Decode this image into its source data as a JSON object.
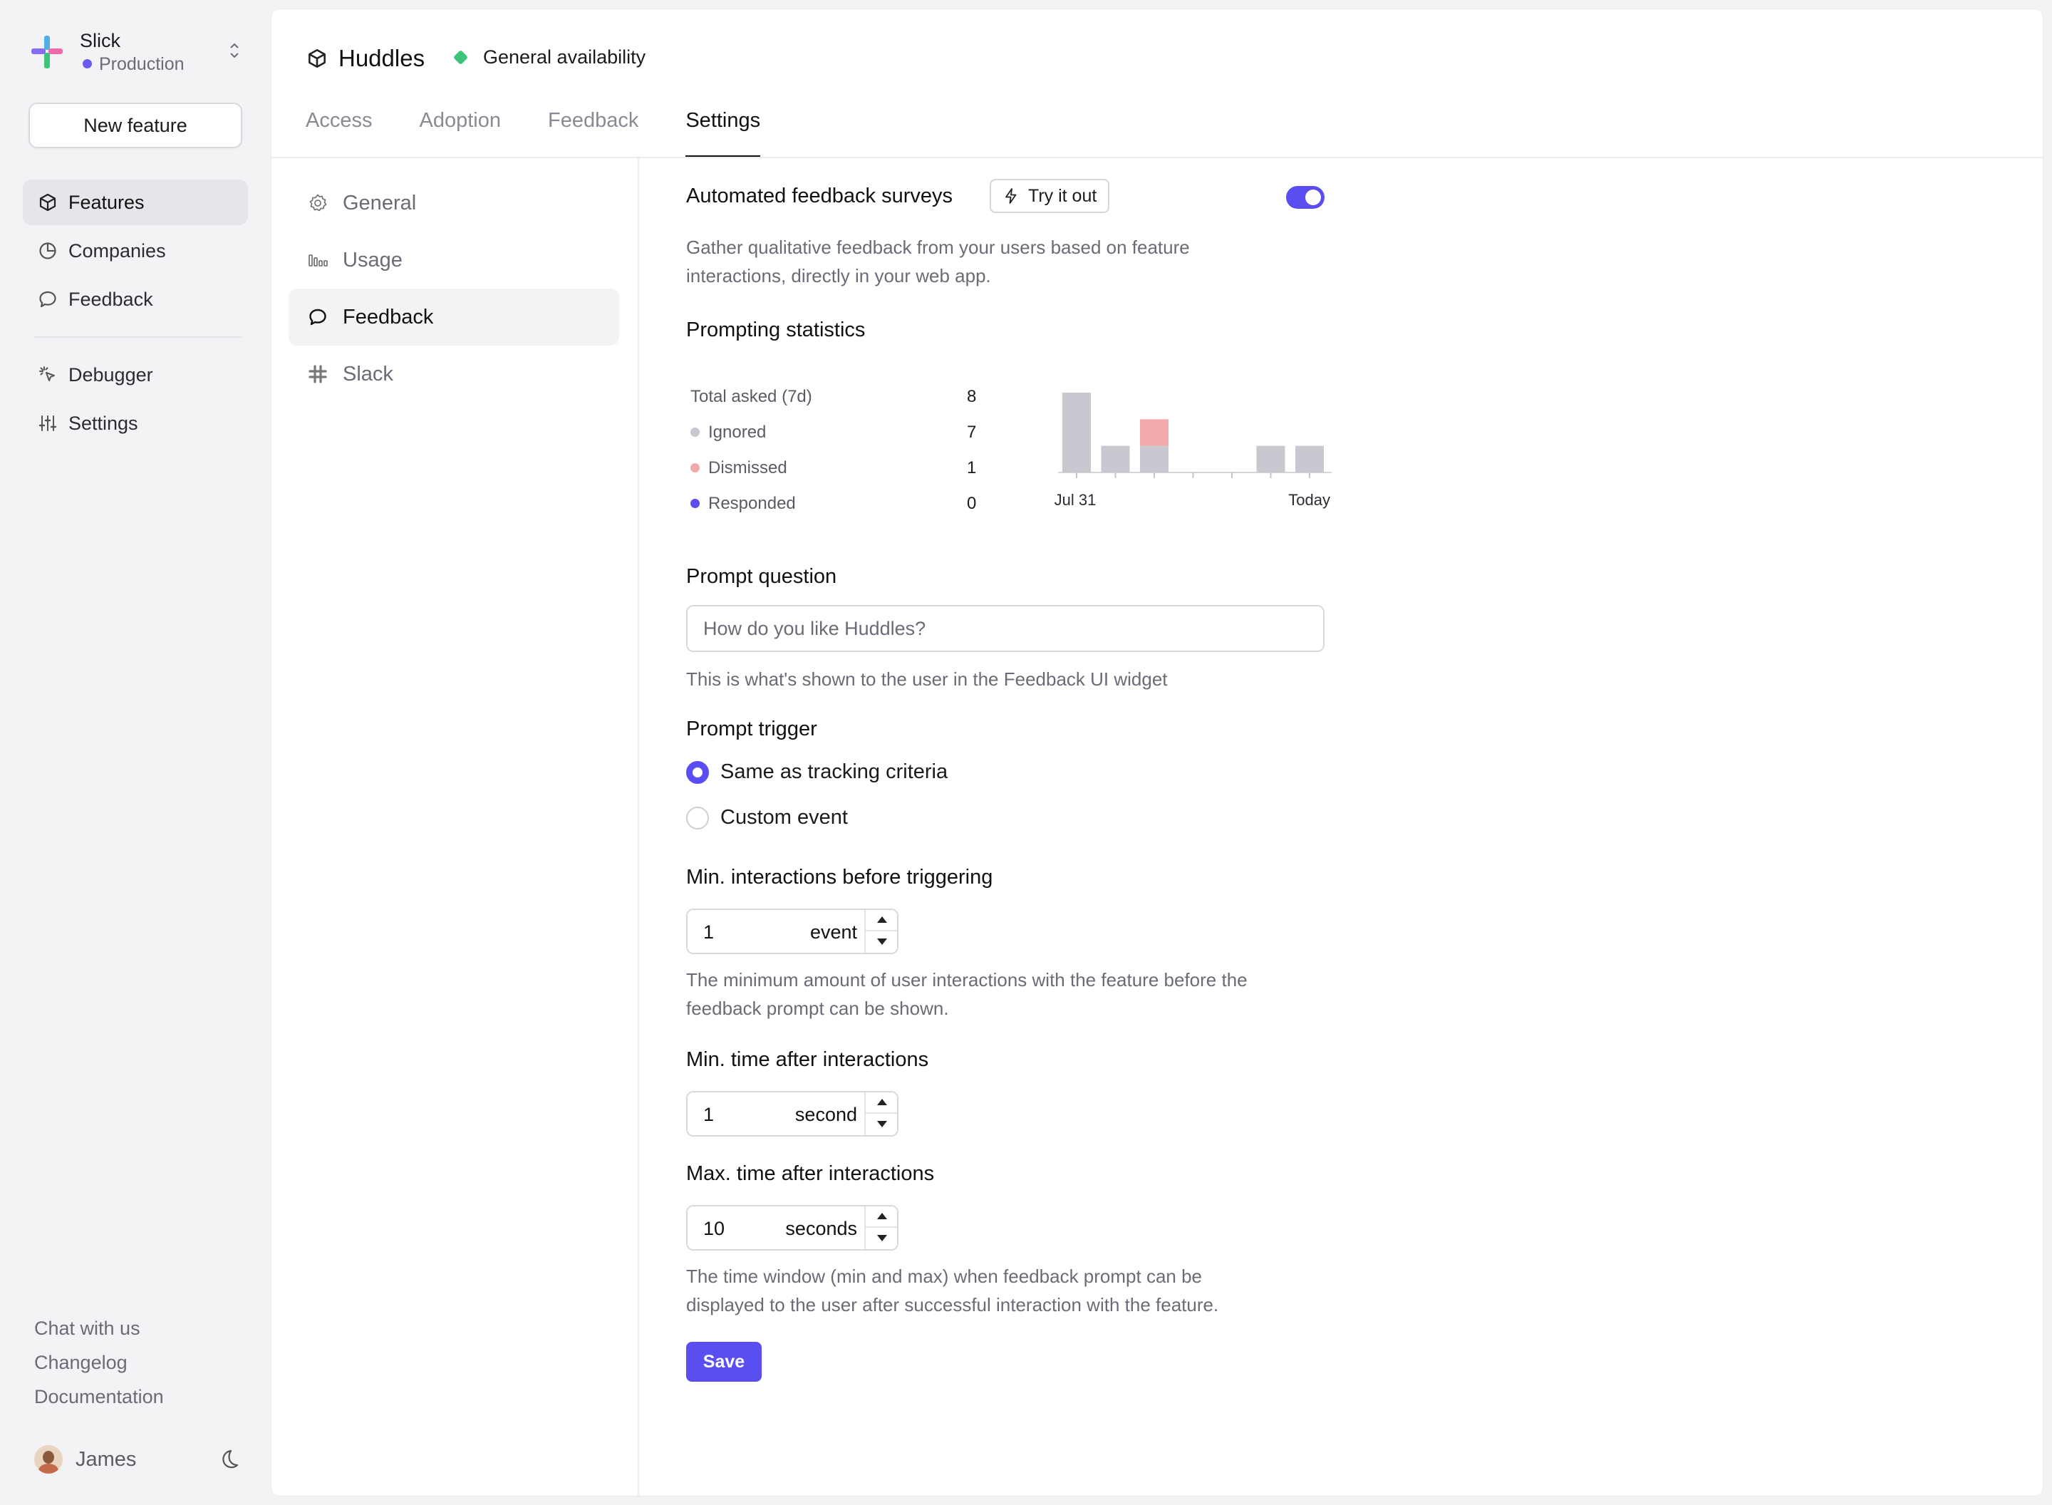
{
  "org": {
    "name": "Slick",
    "environment": "Production"
  },
  "sidebar": {
    "new_feature_label": "New feature",
    "primary": [
      {
        "label": "Features",
        "active": true
      },
      {
        "label": "Companies",
        "active": false
      },
      {
        "label": "Feedback",
        "active": false
      }
    ],
    "secondary": [
      {
        "label": "Debugger"
      },
      {
        "label": "Settings"
      }
    ],
    "footer_links": [
      "Chat with us",
      "Changelog",
      "Documentation"
    ],
    "user_name": "James"
  },
  "header": {
    "title": "Huddles",
    "status_label": "General availability",
    "status_color": "#3ec47a",
    "tabs": [
      {
        "label": "Access",
        "active": false
      },
      {
        "label": "Adoption",
        "active": false
      },
      {
        "label": "Feedback",
        "active": false
      },
      {
        "label": "Settings",
        "active": true
      }
    ]
  },
  "settings_nav": [
    {
      "label": "General",
      "icon": "gear-icon",
      "active": false
    },
    {
      "label": "Usage",
      "icon": "bars-icon",
      "active": false
    },
    {
      "label": "Feedback",
      "icon": "chat-bubble-icon",
      "active": true
    },
    {
      "label": "Slack",
      "icon": "slack-icon",
      "active": false
    }
  ],
  "feedback": {
    "surveys_title": "Automated feedback surveys",
    "try_label": "Try it out",
    "enabled": true,
    "surveys_help": [
      "Gather qualitative feedback from your users based on feature",
      "interactions, directly in your web app."
    ],
    "stats_title": "Prompting statistics",
    "stats": [
      {
        "label": "Total asked (7d)",
        "value": "8",
        "dot": null
      },
      {
        "label": "Ignored",
        "value": "7",
        "dot": "#c8c8d0"
      },
      {
        "label": "Dismissed",
        "value": "1",
        "dot": "#f2a9a9"
      },
      {
        "label": "Responded",
        "value": "0",
        "dot": "#5b4ef0"
      }
    ],
    "prompt_question_label": "Prompt question",
    "prompt_question_placeholder": "How do you like Huddles?",
    "prompt_question_help": "This is what's shown to the user in the Feedback UI widget",
    "prompt_trigger_label": "Prompt trigger",
    "trigger_options": [
      {
        "label": "Same as tracking criteria",
        "checked": true
      },
      {
        "label": "Custom event",
        "checked": false
      }
    ],
    "min_interactions": {
      "label": "Min. interactions before triggering",
      "value": "1",
      "unit": "event",
      "help": [
        "The minimum amount of user interactions with the feature before the",
        "feedback prompt can be shown."
      ]
    },
    "min_time": {
      "label": "Min. time after interactions",
      "value": "1",
      "unit": "second"
    },
    "max_time": {
      "label": "Max. time after interactions",
      "value": "10",
      "unit": "seconds",
      "help": [
        "The time window (min and max) when feedback prompt can be",
        "displayed to the user after successful interaction with the feature."
      ]
    },
    "save_label": "Save"
  },
  "chart_data": {
    "type": "bar",
    "categories": [
      "Jul 31",
      "",
      "",
      "",
      "",
      "",
      "Today"
    ],
    "x_tick_labels": [
      "Jul 31",
      "Today"
    ],
    "series": [
      {
        "name": "Ignored",
        "color": "#c8c8d0",
        "values": [
          3,
          1,
          1,
          0,
          0,
          1,
          1
        ]
      },
      {
        "name": "Dismissed",
        "color": "#f2a9a9",
        "values": [
          0,
          0,
          1,
          0,
          0,
          0,
          0
        ]
      }
    ],
    "stacked": true,
    "ylim": [
      0,
      3
    ],
    "grid": false,
    "legend": "none"
  }
}
